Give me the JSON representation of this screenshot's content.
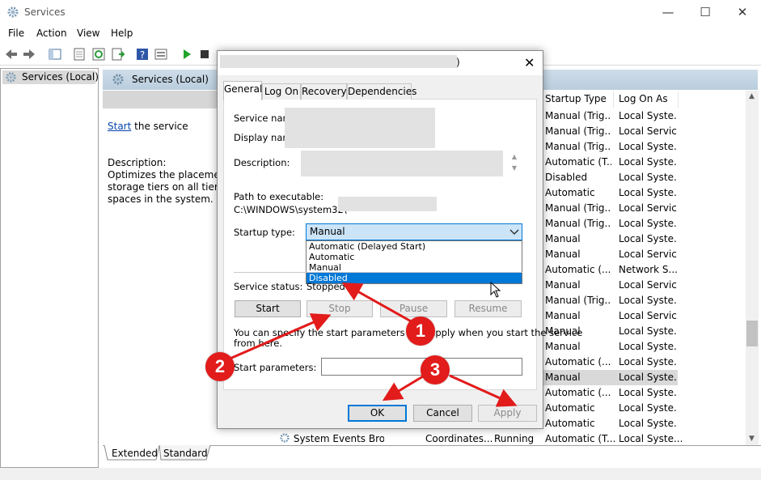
{
  "window": {
    "title": "Services",
    "controls": [
      "—",
      "☐",
      "✕"
    ]
  },
  "menu": [
    "File",
    "Action",
    "View",
    "Help"
  ],
  "left_pane": {
    "root_label": "Services (Local)"
  },
  "services_header": "Services (Local)",
  "info": {
    "start_link": "Start",
    "start_suffix": " the service",
    "description_label": "Description:",
    "description_text": [
      "Optimizes the placement",
      "storage tiers on all tiered s",
      "spaces in the system."
    ]
  },
  "columns": {
    "startup_type": "Startup Type",
    "log_on_as": "Log On As"
  },
  "rows": [
    {
      "startup": "Manual (Trig...",
      "logon": "Local Syste..."
    },
    {
      "startup": "Manual (Trig...",
      "logon": "Local Service"
    },
    {
      "startup": "Manual (Trig...",
      "logon": "Local Syste..."
    },
    {
      "startup": "Automatic (T...",
      "logon": "Local Syste..."
    },
    {
      "startup": "Disabled",
      "logon": "Local Syste..."
    },
    {
      "startup": "Automatic",
      "logon": "Local Syste..."
    },
    {
      "startup": "Manual (Trig...",
      "logon": "Local Service"
    },
    {
      "startup": "Manual (Trig...",
      "logon": "Local Syste..."
    },
    {
      "startup": "Manual",
      "logon": "Local Syste..."
    },
    {
      "startup": "Manual",
      "logon": "Local Service"
    },
    {
      "startup": "Automatic (...",
      "logon": "Network S..."
    },
    {
      "startup": "Manual",
      "logon": "Local Service"
    },
    {
      "startup": "Manual (Trig...",
      "logon": "Local Syste..."
    },
    {
      "startup": "Manual",
      "logon": "Local Service"
    },
    {
      "startup": "Manual",
      "logon": "Local Syste..."
    },
    {
      "startup": "Manual",
      "logon": "Local Syste..."
    },
    {
      "startup": "Automatic (...",
      "logon": "Local Syste..."
    },
    {
      "startup": "Manual",
      "logon": "Local Syste..."
    },
    {
      "startup": "Automatic (...",
      "logon": "Local Syste..."
    },
    {
      "startup": "Automatic",
      "logon": "Local Syste..."
    },
    {
      "startup": "Automatic",
      "logon": "Local Syste..."
    }
  ],
  "last_row": {
    "name": "System Events Broker",
    "description": "Coordinates...",
    "status": "Running",
    "startup": "Automatic (T...",
    "logon": "Local Syste..."
  },
  "bottom_tabs": [
    "Extended",
    "Standard"
  ],
  "dialog": {
    "title_suffix": ")",
    "close": "✕",
    "tabs": [
      "General",
      "Log On",
      "Recovery",
      "Dependencies"
    ],
    "service_name_label": "Service name",
    "display_name_label": "Display name:",
    "description_label": "Description:",
    "path_label": "Path to executable:",
    "path_value": "C:\\WINDOWS\\system32\\",
    "startup_type_label": "Startup type:",
    "startup_type_value": "Manual",
    "startup_options": [
      "Automatic (Delayed Start)",
      "Automatic",
      "Manual",
      "Disabled"
    ],
    "service_status_label": "Service status:",
    "service_status_value": "Stopped",
    "buttons": {
      "start": "Start",
      "stop": "Stop",
      "pause": "Pause",
      "resume": "Resume"
    },
    "params_hint_1": "You can specify the start parameters that apply when you start the service",
    "params_hint_2": "from here.",
    "start_params_label": "Start parameters:",
    "ok": "OK",
    "cancel": "Cancel",
    "apply": "Apply"
  },
  "annotations": {
    "badge1": "1",
    "badge2": "2",
    "badge3": "3",
    "color": "#e21b1b"
  }
}
